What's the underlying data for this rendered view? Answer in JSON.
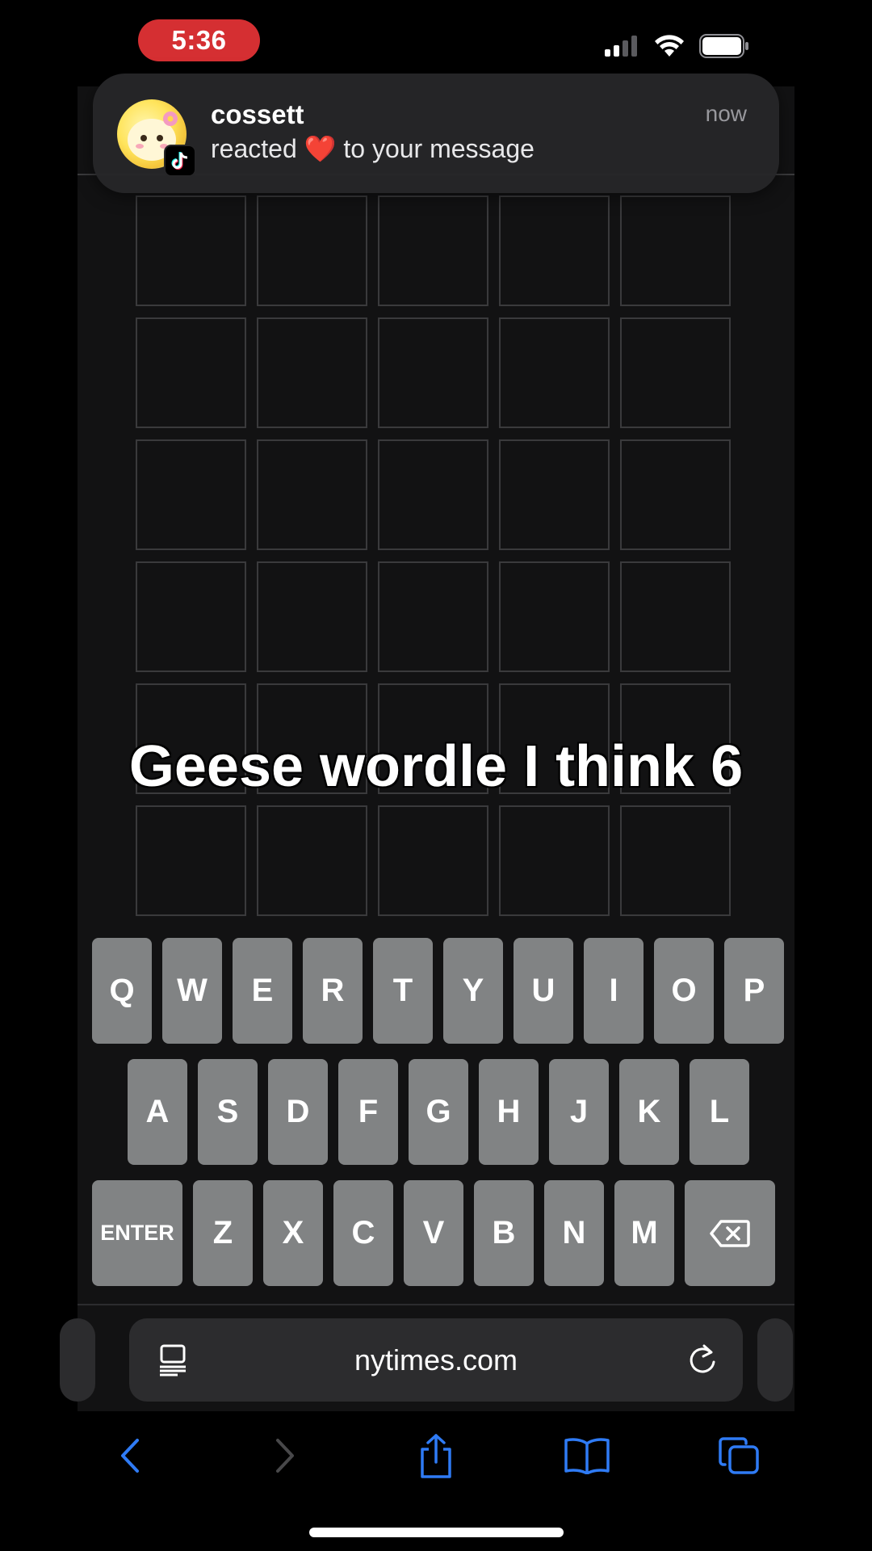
{
  "status_bar": {
    "time": "5:36"
  },
  "notification": {
    "sender": "cossett",
    "message": "reacted ❤️ to your message",
    "time": "now"
  },
  "game": {
    "rows": 6,
    "columns": 5,
    "tiles": [
      [
        "",
        "",
        "",
        "",
        ""
      ],
      [
        "",
        "",
        "",
        "",
        ""
      ],
      [
        "",
        "",
        "",
        "",
        ""
      ],
      [
        "",
        "",
        "",
        "",
        ""
      ],
      [
        "",
        "",
        "",
        "",
        ""
      ],
      [
        "",
        "",
        "",
        "",
        ""
      ]
    ]
  },
  "keyboard": {
    "row1": [
      "Q",
      "W",
      "E",
      "R",
      "T",
      "Y",
      "U",
      "I",
      "O",
      "P"
    ],
    "row2": [
      "A",
      "S",
      "D",
      "F",
      "G",
      "H",
      "J",
      "K",
      "L"
    ],
    "row3": [
      "ENTER",
      "Z",
      "X",
      "C",
      "V",
      "B",
      "N",
      "M",
      "⌫"
    ]
  },
  "browser": {
    "url": "nytimes.com"
  },
  "caption": "Geese wordle I think 6",
  "colors": {
    "tile_border": "#3a3a3c",
    "key_bg": "#818384",
    "background": "#121213",
    "time_pill": "#d52f32",
    "accent": "#2f7bf5"
  }
}
